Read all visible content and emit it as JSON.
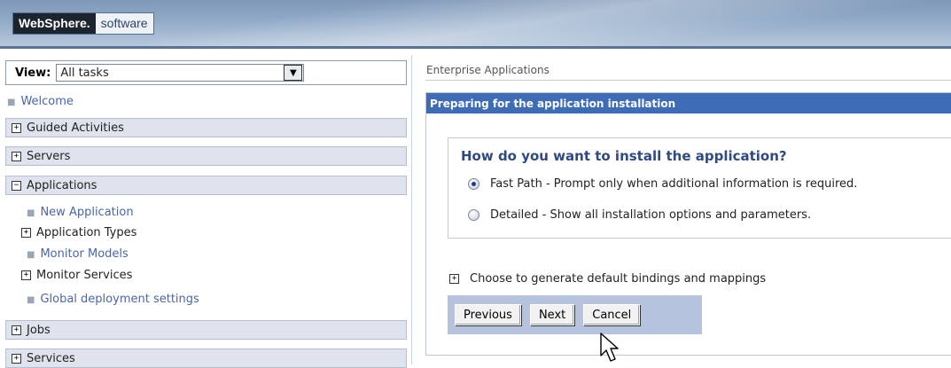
{
  "header": {
    "brand": "WebSphere.",
    "product": "software"
  },
  "nav": {
    "view_label": "View:",
    "view_value": "All tasks",
    "welcome": "Welcome",
    "categories": [
      {
        "label": "Guided Activities",
        "expanded": false
      },
      {
        "label": "Servers",
        "expanded": false
      },
      {
        "label": "Applications",
        "expanded": true
      },
      {
        "label": "Jobs",
        "expanded": false
      },
      {
        "label": "Services",
        "expanded": false
      }
    ],
    "applications_children": [
      {
        "label": "New Application",
        "type": "link"
      },
      {
        "label": "Application Types",
        "type": "expandable"
      },
      {
        "label": "Monitor Models",
        "type": "link"
      },
      {
        "label": "Monitor Services",
        "type": "expandable"
      },
      {
        "label": "Global deployment settings",
        "type": "link"
      }
    ]
  },
  "main": {
    "breadcrumb": "Enterprise Applications",
    "panel_title": "Preparing for the application installation",
    "question": "How do you want to install the application?",
    "options": [
      {
        "label": "Fast Path - Prompt only when additional information is required.",
        "selected": true
      },
      {
        "label": "Detailed - Show all installation options and parameters.",
        "selected": false
      }
    ],
    "bindings_label": "Choose to generate default bindings and mappings",
    "buttons": {
      "previous": "Previous",
      "next": "Next",
      "cancel": "Cancel"
    }
  },
  "colors": {
    "panel_title_bg": "#3e6cb6",
    "link": "#4a66a8",
    "nav_category_bg": "#dfe3ee",
    "button_bar_bg": "#b6c3de"
  }
}
